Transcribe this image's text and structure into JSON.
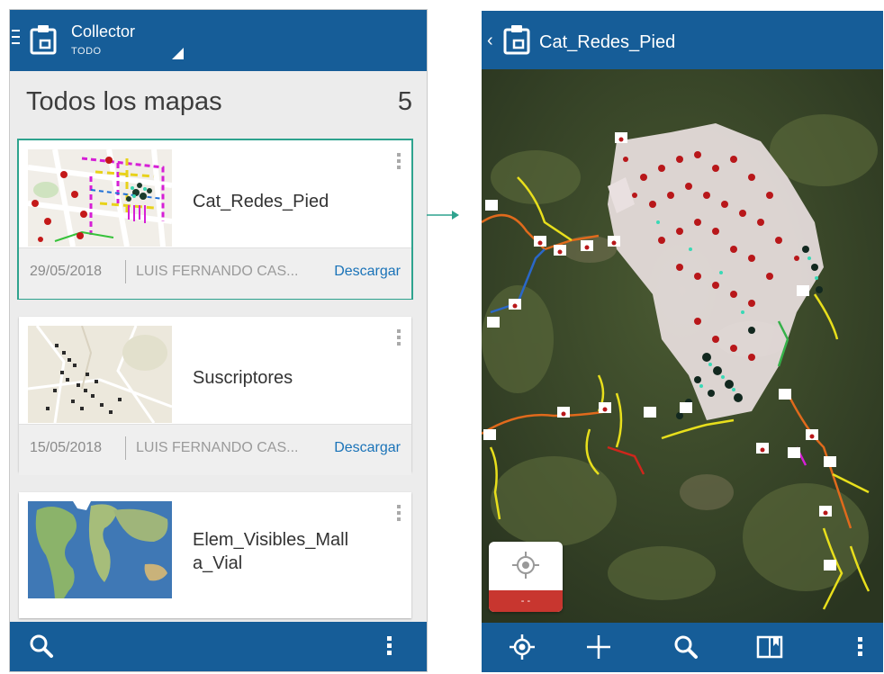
{
  "left_screen": {
    "app_title": "Collector",
    "app_subtitle": "TODO",
    "maps_title": "Todos los mapas",
    "maps_count": "5",
    "cards": [
      {
        "name": "Cat_Redes_Pied",
        "date": "29/05/2018",
        "owner": "LUIS FERNANDO CAS...",
        "action": "Descargar"
      },
      {
        "name": "Suscriptores",
        "date": "15/05/2018",
        "owner": "LUIS FERNANDO CAS...",
        "action": "Descargar"
      },
      {
        "name": "Elem_Visibles_Mall\na_Vial"
      }
    ]
  },
  "right_screen": {
    "map_title": "Cat_Redes_Pied",
    "accuracy": "- -",
    "toolbar": [
      "locate-icon",
      "add-icon",
      "search-icon",
      "bookmark-icon",
      "more-icon"
    ]
  },
  "colors": {
    "appbar": "#165d98",
    "link": "#1a73b8",
    "selected_outline": "#2ea38e",
    "accuracy_bar": "#c8362f"
  }
}
